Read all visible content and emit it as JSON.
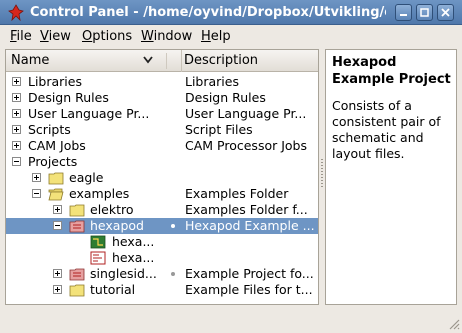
{
  "window": {
    "title": "Control Panel - /home/oyvind/Dropbox/Utvikling/e"
  },
  "menu": [
    {
      "label_u": "F",
      "label_rest": "ile"
    },
    {
      "label_u": "V",
      "label_rest": "iew"
    },
    {
      "label_u": "O",
      "label_rest": "ptions"
    },
    {
      "label_u": "W",
      "label_rest": "indow"
    },
    {
      "label_u": "H",
      "label_rest": "elp"
    }
  ],
  "columns": {
    "name": "Name",
    "description": "Description"
  },
  "tree": [
    {
      "name": "Libraries",
      "description": "Libraries",
      "expander": "plus"
    },
    {
      "name": "Design Rules",
      "description": "Design Rules",
      "expander": "plus"
    },
    {
      "name": "User Language Pr...",
      "description": "User Language Pr...",
      "expander": "plus"
    },
    {
      "name": "Scripts",
      "description": "Script Files",
      "expander": "plus"
    },
    {
      "name": "CAM Jobs",
      "description": "CAM Processor Jobs",
      "expander": "plus"
    },
    {
      "name": "Projects",
      "description": "",
      "expander": "minus"
    },
    {
      "name": "eagle",
      "description": "",
      "expander": "plus",
      "icon": "folder-icon"
    },
    {
      "name": "examples",
      "description": "Examples Folder",
      "expander": "minus",
      "icon": "open-folder-icon"
    },
    {
      "name": "elektro",
      "description": "Examples Folder f...",
      "expander": "plus",
      "icon": "folder-icon"
    },
    {
      "name": "hexapod",
      "description": "Hexapod Example ...",
      "expander": "minus",
      "icon": "project-icon",
      "selected": true
    },
    {
      "name": "hexa...",
      "description": "",
      "icon": "board-icon"
    },
    {
      "name": "hexa...",
      "description": "",
      "icon": "schematic-icon"
    },
    {
      "name": "singlesid...",
      "description": "Example Project fo...",
      "expander": "plus",
      "icon": "project-icon"
    },
    {
      "name": "tutorial",
      "description": "Example Files for t...",
      "expander": "plus",
      "icon": "folder-icon"
    }
  ],
  "info": {
    "title": "Hexapod Example Project",
    "text": "Consists of a consistent pair of schematic and layout files."
  },
  "colors": {
    "titlebar": "#5a83b6",
    "selection": "#6e95c4",
    "folder": "#f3e27a"
  }
}
